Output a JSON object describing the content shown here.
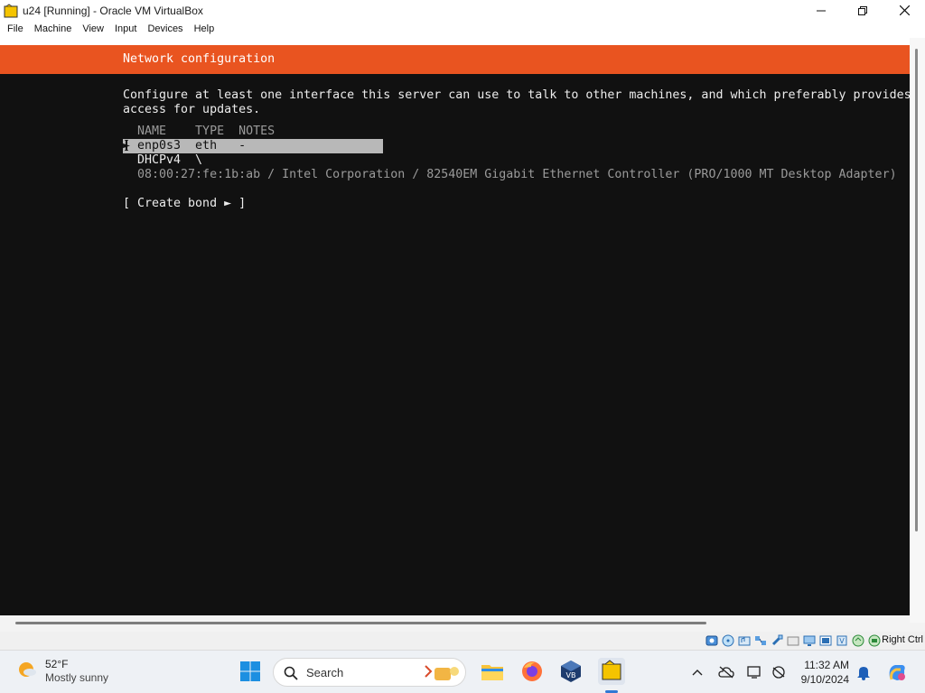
{
  "window": {
    "title": "u24 [Running] - Oracle VM VirtualBox",
    "minimize_icon": "minimize-icon",
    "maximize_icon": "maximize-icon",
    "close_icon": "close-icon"
  },
  "menu": [
    "File",
    "Machine",
    "View",
    "Input",
    "Devices",
    "Help"
  ],
  "installer": {
    "header": "Network configuration",
    "description_line1": "Configure at least one interface this server can use to talk to other machines, and which preferably provides",
    "description_line2": "access for updates.",
    "columns_header": "  NAME    TYPE  NOTES",
    "interface_row_left": "[ enp0s3  eth   -",
    "interface_row_arrow": "►",
    "interface_row_right": "]",
    "dhcp_line": "  DHCPv4  \\",
    "hw_line": "  08:00:27:fe:1b:ab / Intel Corporation / 82540EM Gigabit Ethernet Controller (PRO/1000 MT Desktop Adapter)",
    "create_bond": "[ Create bond ► ]"
  },
  "statusbar": {
    "icons": [
      "hard-disk-icon",
      "optical-drive-icon",
      "audio-icon",
      "network-icon",
      "usb-icon",
      "shared-folder-icon",
      "display-icon",
      "recording-icon",
      "cpu-icon",
      "mouse-integration-icon",
      "keyboard-icon"
    ],
    "host_key": "Right Ctrl"
  },
  "taskbar": {
    "weather_temp": "52°F",
    "weather_desc": "Mostly sunny",
    "search_label": "Search",
    "time": "11:32 AM",
    "date": "9/10/2024"
  },
  "colors": {
    "ubuntu_orange": "#e95420",
    "terminal_bg": "#111111",
    "selection_bg": "#b8b8b8"
  }
}
